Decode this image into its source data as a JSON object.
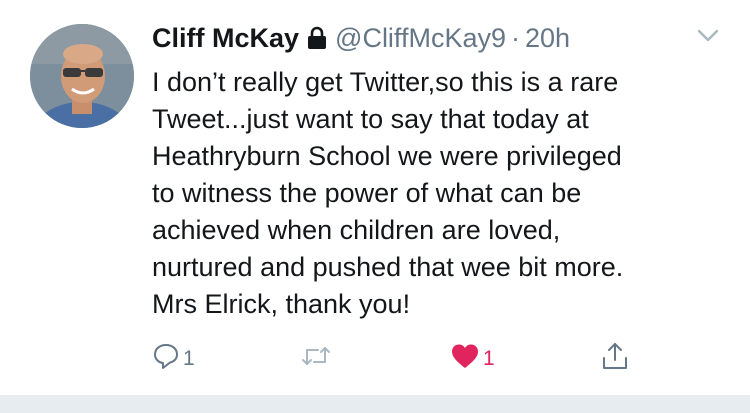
{
  "tweet": {
    "display_name": "Cliff McKay",
    "handle": "@CliffMcKay9",
    "separator": "·",
    "time": "20h",
    "protected_icon": "lock-icon",
    "menu_icon": "chevron-down-icon",
    "text": "I don’t really get Twitter,so this is a rare\nTweet...just want to say that today at\nHeathryburn School we were privileged\nto witness the power of what can be\nachieved when children are loved,\nnurtured and pushed that wee bit more.\nMrs Elrick, thank you!"
  },
  "actions": {
    "reply": {
      "icon": "reply-icon",
      "count": "1"
    },
    "retweet": {
      "icon": "retweet-icon",
      "count": ""
    },
    "like": {
      "icon": "heart-icon",
      "count": "1",
      "active": true
    },
    "share": {
      "icon": "share-icon"
    }
  },
  "colors": {
    "text": "#14171a",
    "secondary": "#657786",
    "like": "#e0245e",
    "divider": "#e6ecf0"
  }
}
